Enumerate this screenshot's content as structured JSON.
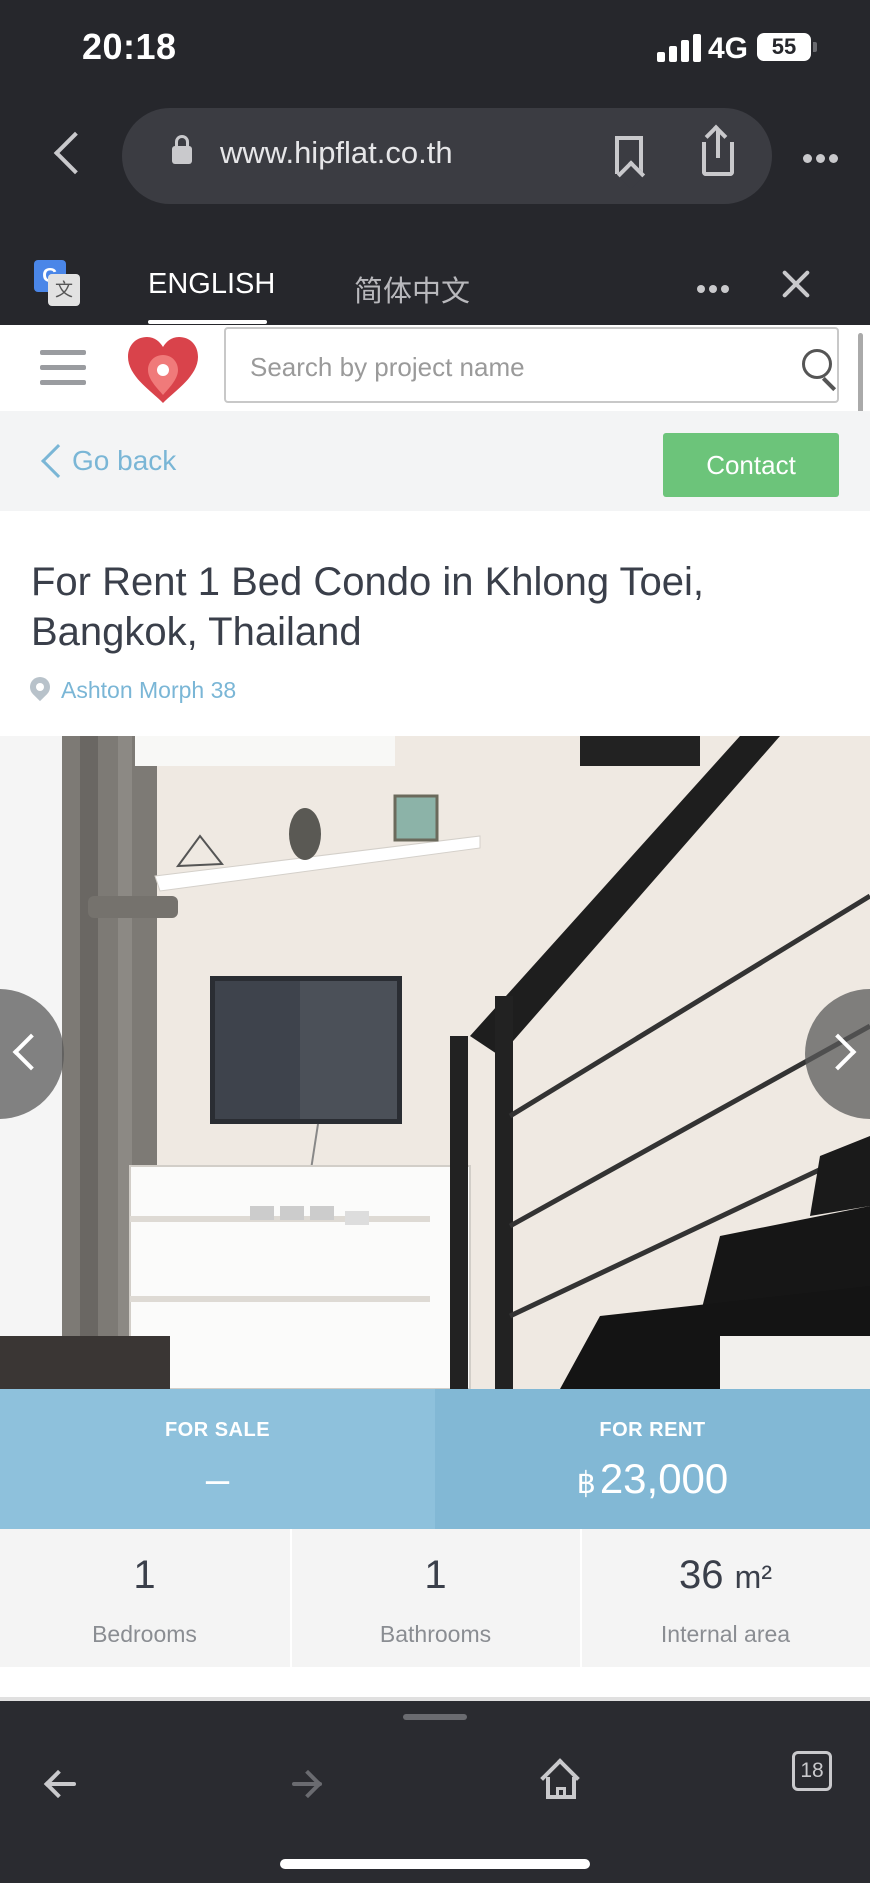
{
  "status_bar": {
    "time": "20:18",
    "network": "4G",
    "battery": "55"
  },
  "browser": {
    "url": "www.hipflat.co.th",
    "icons": [
      "back-icon",
      "lock-icon",
      "bookmark-icon",
      "share-icon",
      "more-icon"
    ]
  },
  "translate_bar": {
    "tabs": [
      {
        "label": "ENGLISH",
        "active": true
      },
      {
        "label": "简体中文",
        "active": false
      }
    ],
    "icons": [
      "google-translate-icon",
      "more-icon",
      "close-icon"
    ]
  },
  "header": {
    "search_placeholder": "Search by project name",
    "icons": [
      "hamburger-menu-icon",
      "hipflat-logo",
      "search-icon"
    ]
  },
  "subbar": {
    "back_label": "Go back",
    "contact_label": "Contact",
    "contact_color": "#6cc47a",
    "link_color": "#7ab6d6"
  },
  "listing": {
    "title": "For Rent 1 Bed Condo in Khlong Toei, Bangkok, Thailand",
    "project": "Ashton Morph 38"
  },
  "prices": {
    "sale_label": "FOR SALE",
    "sale_value": "–",
    "rent_label": "FOR RENT",
    "rent_currency": "฿",
    "rent_value": "23,000"
  },
  "specs": [
    {
      "value": "1",
      "label": "Bedrooms"
    },
    {
      "value": "1",
      "label": "Bathrooms"
    },
    {
      "value": "36",
      "unit": "m²",
      "label": "Internal area"
    }
  ],
  "toolbar": {
    "tabs_count": "18",
    "icons": [
      "back-arrow-icon",
      "forward-arrow-icon",
      "home-icon",
      "tabs-icon"
    ]
  }
}
